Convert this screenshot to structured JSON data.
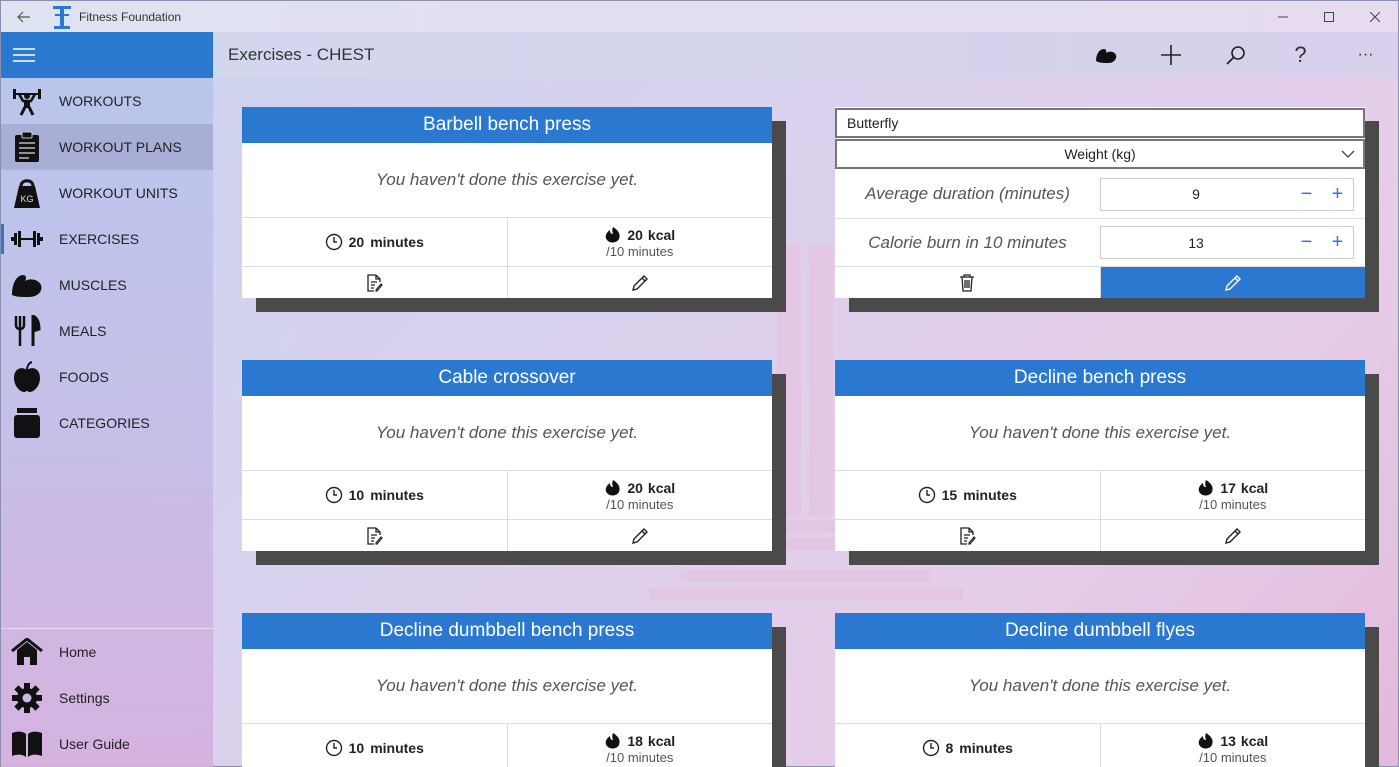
{
  "window": {
    "title": "Fitness Foundation",
    "controls": [
      "minimize",
      "maximize",
      "close"
    ]
  },
  "header": {
    "page_title": "Exercises - CHEST",
    "actions": [
      "muscle-icon",
      "add-icon",
      "search-icon",
      "help-icon",
      "more-icon"
    ],
    "help_label": "?",
    "more_label": "···"
  },
  "sidebar": {
    "items": [
      {
        "label": "WORKOUTS",
        "icon": "weightlifter-icon"
      },
      {
        "label": "WORKOUT PLANS",
        "icon": "clipboard-icon"
      },
      {
        "label": "WORKOUT UNITS",
        "icon": "kettlebell-icon",
        "icon_text": "KG"
      },
      {
        "label": "EXERCISES",
        "icon": "dumbbell-icon"
      },
      {
        "label": "MUSCLES",
        "icon": "bicep-icon"
      },
      {
        "label": "MEALS",
        "icon": "cutlery-icon"
      },
      {
        "label": "FOODS",
        "icon": "apple-icon"
      },
      {
        "label": "CATEGORIES",
        "icon": "stack-icon"
      }
    ],
    "bottom_items": [
      {
        "label": "Home",
        "icon": "home-icon"
      },
      {
        "label": "Settings",
        "icon": "gear-icon"
      },
      {
        "label": "User Guide",
        "icon": "book-icon"
      }
    ]
  },
  "common": {
    "not_done_message": "You haven't done this exercise yet.",
    "minutes_unit": "minutes",
    "kcal_unit": "kcal",
    "per_label": "/10 minutes"
  },
  "cards": [
    {
      "name": "Barbell bench press",
      "duration": "20",
      "kcal": "20"
    },
    {
      "name": "Cable crossover",
      "duration": "10",
      "kcal": "20"
    },
    {
      "name": "Decline bench press",
      "duration": "15",
      "kcal": "17"
    },
    {
      "name": "Decline dumbbell bench press",
      "duration": "10",
      "kcal": "18"
    },
    {
      "name": "Decline dumbbell flyes",
      "duration": "8",
      "kcal": "13"
    }
  ],
  "edit_card": {
    "name_value": "Butterfly",
    "type_value": "Weight (kg)",
    "avg_duration_label": "Average duration (minutes)",
    "avg_duration_value": "9",
    "calorie_label": "Calorie burn in 10 minutes",
    "calorie_value": "13",
    "minus": "−",
    "plus": "+"
  },
  "colors": {
    "accent": "#2b78d0",
    "shadow": "#4a4a4a"
  }
}
